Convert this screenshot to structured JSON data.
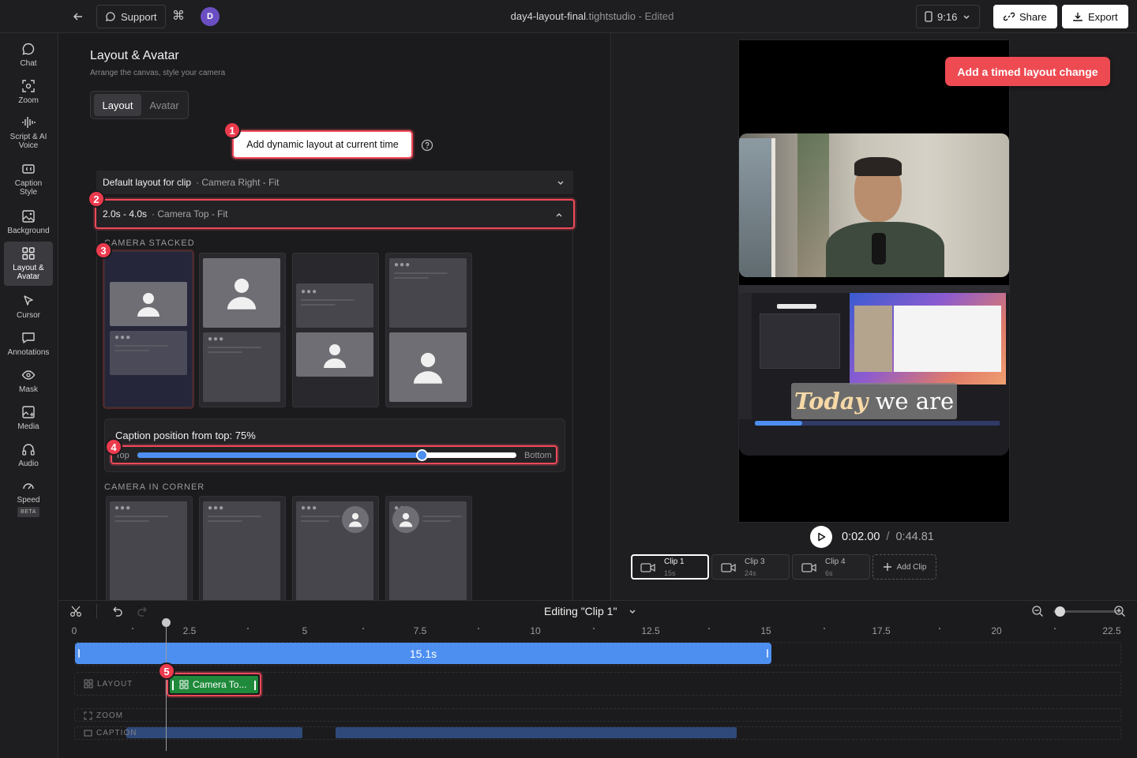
{
  "topbar": {
    "support_label": "Support",
    "cmd_glyph": "⌘",
    "avatar_initial": "D",
    "file_name": "day4-layout-final",
    "file_ext": ".tightstudio",
    "status": " - Edited",
    "aspect_label": "9:16",
    "share_label": "Share",
    "export_label": "Export"
  },
  "sidebar": {
    "items": [
      {
        "label": "Chat",
        "icon": "chat-icon"
      },
      {
        "label": "Zoom",
        "icon": "zoom-icon"
      },
      {
        "label": "Script & AI Voice",
        "icon": "voice-wave-icon"
      },
      {
        "label": "Caption Style",
        "icon": "caption-icon"
      },
      {
        "label": "Background",
        "icon": "image-icon"
      },
      {
        "label": "Layout & Avatar",
        "icon": "layout-grid-icon"
      },
      {
        "label": "Cursor",
        "icon": "cursor-icon"
      },
      {
        "label": "Annotations",
        "icon": "annotation-icon"
      },
      {
        "label": "Mask",
        "icon": "eye-icon"
      },
      {
        "label": "Media",
        "icon": "media-icon"
      },
      {
        "label": "Audio",
        "icon": "headphones-icon"
      },
      {
        "label": "Speed",
        "icon": "speedometer-icon",
        "badge": "BETA"
      }
    ]
  },
  "panel": {
    "title": "Layout & Avatar",
    "subtitle": "Arrange the canvas, style your camera",
    "tabs": [
      "Layout",
      "Avatar"
    ],
    "add_dynamic_label": "Add dynamic layout at current time",
    "default_layout_label": "Default layout for clip",
    "default_layout_value": "· Camera Right - Fit",
    "segment_range": "2.0s - 4.0s",
    "segment_value": "· Camera Top - Fit",
    "camera_stacked_label": "CAMERA STACKED",
    "caption_position_label": "Caption position from top: 75%",
    "caption_position_value": 75,
    "slider_top_label": "Top",
    "slider_bottom_label": "Bottom",
    "camera_corner_label": "CAMERA IN CORNER",
    "badges": [
      "1",
      "2",
      "3",
      "4"
    ]
  },
  "preview": {
    "callout": "Add a timed layout change",
    "caption_overlay_italic": "Today",
    "caption_overlay_rest": " we are",
    "time_current": "0:02.00",
    "time_sep": "/",
    "time_total": "0:44.81",
    "clips": [
      {
        "name": "Clip 1",
        "duration": "15s",
        "selected": true
      },
      {
        "name": "Clip 3",
        "duration": "24s",
        "selected": false
      },
      {
        "name": "Clip 4",
        "duration": "6s",
        "selected": false
      }
    ],
    "add_clip_label": "Add Clip"
  },
  "timeline": {
    "editing_label": "Editing \"Clip 1\"",
    "ticks": [
      "0",
      "2.5",
      "5",
      "7.5",
      "10",
      "12.5",
      "15",
      "17.5",
      "20",
      "22.5"
    ],
    "clip_bar_label": "15.1s",
    "layout_track_label": "LAYOUT",
    "layout_chip_label": "Camera To...",
    "zoom_track_label": "ZOOM",
    "caption_track_label": "CAPTION",
    "badge_5": "5",
    "zoom_slider_fraction": 0.05
  },
  "colors": {
    "accent_blue": "#4d8ff0",
    "highlight_red": "#ef4a5a",
    "callout_red": "#ee4a52",
    "layout_green": "#1f8a3b"
  }
}
